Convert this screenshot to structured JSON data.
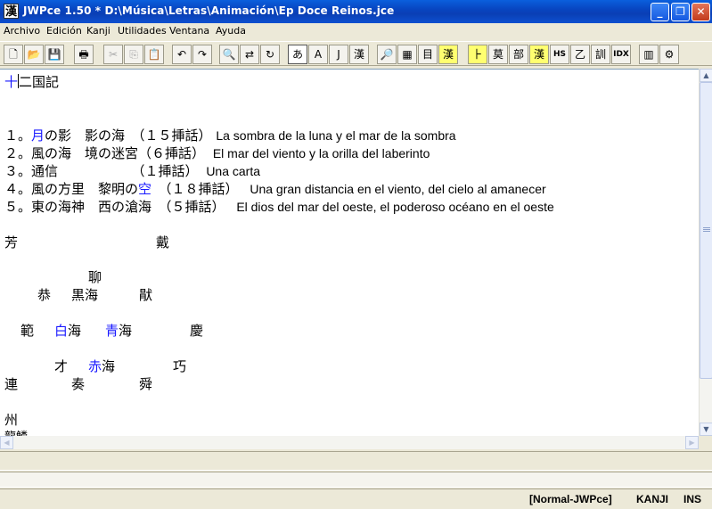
{
  "window": {
    "title": "JWPce 1.50 * D:\\Música\\Letras\\Animación\\Ep Doce Reinos.jce",
    "app_icon_glyph": "漢"
  },
  "menu": [
    "Archivo",
    "Edición",
    "Kanji",
    "Utilidades",
    "Ventana",
    "Ayuda"
  ],
  "toolbar": {
    "kana_label": "あ",
    "ascii_label": "A",
    "jascii_label": "J",
    "kanji_label": "漢",
    "hs_label": "HS",
    "idx_label": "IDX"
  },
  "document": {
    "heading_pre": "十",
    "heading_post": "二国記",
    "episodes": [
      {
        "num": "１。",
        "ja_blue": "月",
        "ja_rest": "の影　影の海　（１５挿話）",
        "es": "La sombra de la luna y el mar de la sombra"
      },
      {
        "num": "２。",
        "ja_blue": "",
        "ja_rest": "風の海　境の迷宮（６挿話）",
        "es": "El mar del viento y la orilla del laberinto"
      },
      {
        "num": "３。",
        "ja_blue": "",
        "ja_rest": "通信　　　　　　（１挿話）",
        "es": "Una carta"
      },
      {
        "num": "４。",
        "ja_pre": "風の方里　黎明の",
        "ja_blue2": "空",
        "ja_rest": "　（１８挿話）",
        "es": "Una gran distancia en el viento, del cielo al amanecer"
      },
      {
        "num": "５。",
        "ja_blue": "",
        "ja_rest": "東の海神　西の滄海　（５挿話）",
        "es": "El dios del mar del oeste, el poderoso océano en el oeste"
      }
    ],
    "map": {
      "houkou": "芳",
      "tai": "戴",
      "ryuu": "聊",
      "kyou_kingdom": "恭",
      "kokkai": "黒海",
      "en": "猒",
      "han": "範",
      "haku": "白",
      "kai1": "海",
      "sei": "青",
      "kai2": "海",
      "kei": "慶",
      "sai": "才",
      "seki": "赤",
      "kai3": "海",
      "kou": "巧",
      "ren": "連",
      "sou": "奏",
      "shun": "舜",
      "shuu": "州",
      "partial": "龍鱗"
    }
  },
  "status": {
    "mode": "[Normal-JWPce]",
    "input": "KANJI",
    "insert": "INS"
  }
}
